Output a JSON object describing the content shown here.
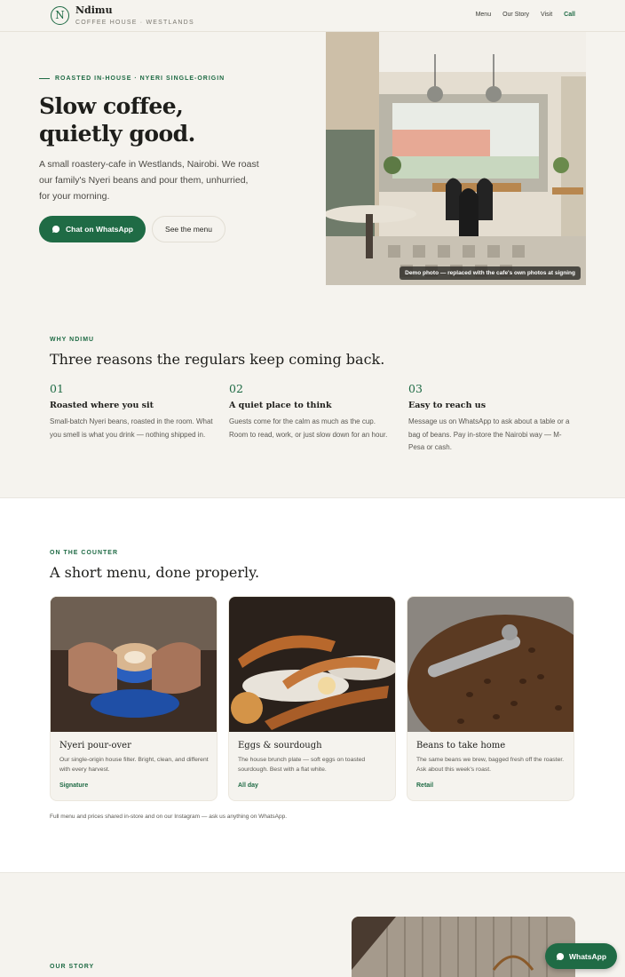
{
  "nav": {
    "brand_initial": "N",
    "brand_name": "Ndimu",
    "brand_sub": "COFFEE HOUSE · WESTLANDS",
    "links": [
      "Menu",
      "Our Story",
      "Visit"
    ],
    "call": "Call"
  },
  "hero": {
    "eyebrow": "ROASTED IN-HOUSE · NYERI SINGLE-ORIGIN",
    "title_line1": "Slow coffee,",
    "title_line2": "quietly good.",
    "description": "A small roastery-cafe in Westlands, Nairobi. We roast our family's Nyeri beans and pour them, unhurried, for your morning.",
    "cta_whatsapp": "Chat on WhatsApp",
    "cta_menu": "See the menu",
    "photo_caption": "Demo photo — replaced with the cafe's own photos at signing"
  },
  "why": {
    "eyebrow": "WHY NDIMU",
    "title": "Three reasons the regulars keep coming back.",
    "reasons": [
      {
        "num": "01",
        "title": "Roasted where you sit",
        "body": "Small-batch Nyeri beans, roasted in the room. What you smell is what you drink — nothing shipped in."
      },
      {
        "num": "02",
        "title": "A quiet place to think",
        "body": "Guests come for the calm as much as the cup. Room to read, work, or just slow down for an hour."
      },
      {
        "num": "03",
        "title": "Easy to reach us",
        "body": "Message us on WhatsApp to ask about a table or a bag of beans. Pay in-store the Nairobi way — M-Pesa or cash."
      }
    ]
  },
  "menu": {
    "eyebrow": "ON THE COUNTER",
    "title": "A short menu, done properly.",
    "cards": [
      {
        "title": "Nyeri pour-over",
        "body": "Our single-origin house filter. Bright, clean, and different with every harvest.",
        "tag": "Signature"
      },
      {
        "title": "Eggs & sourdough",
        "body": "The house brunch plate — soft eggs on toasted sourdough. Best with a flat white.",
        "tag": "All day"
      },
      {
        "title": "Beans to take home",
        "body": "The same beans we brew, bagged fresh off the roaster. Ask about this week's roast.",
        "tag": "Retail"
      }
    ],
    "note": "Full menu and prices shared in-store and on our Instagram — ask us anything on WhatsApp."
  },
  "story": {
    "eyebrow": "OUR STORY"
  },
  "floating": {
    "whatsapp": "WhatsApp"
  },
  "colors": {
    "accent": "#1f6b45",
    "background": "#f5f3ee"
  }
}
